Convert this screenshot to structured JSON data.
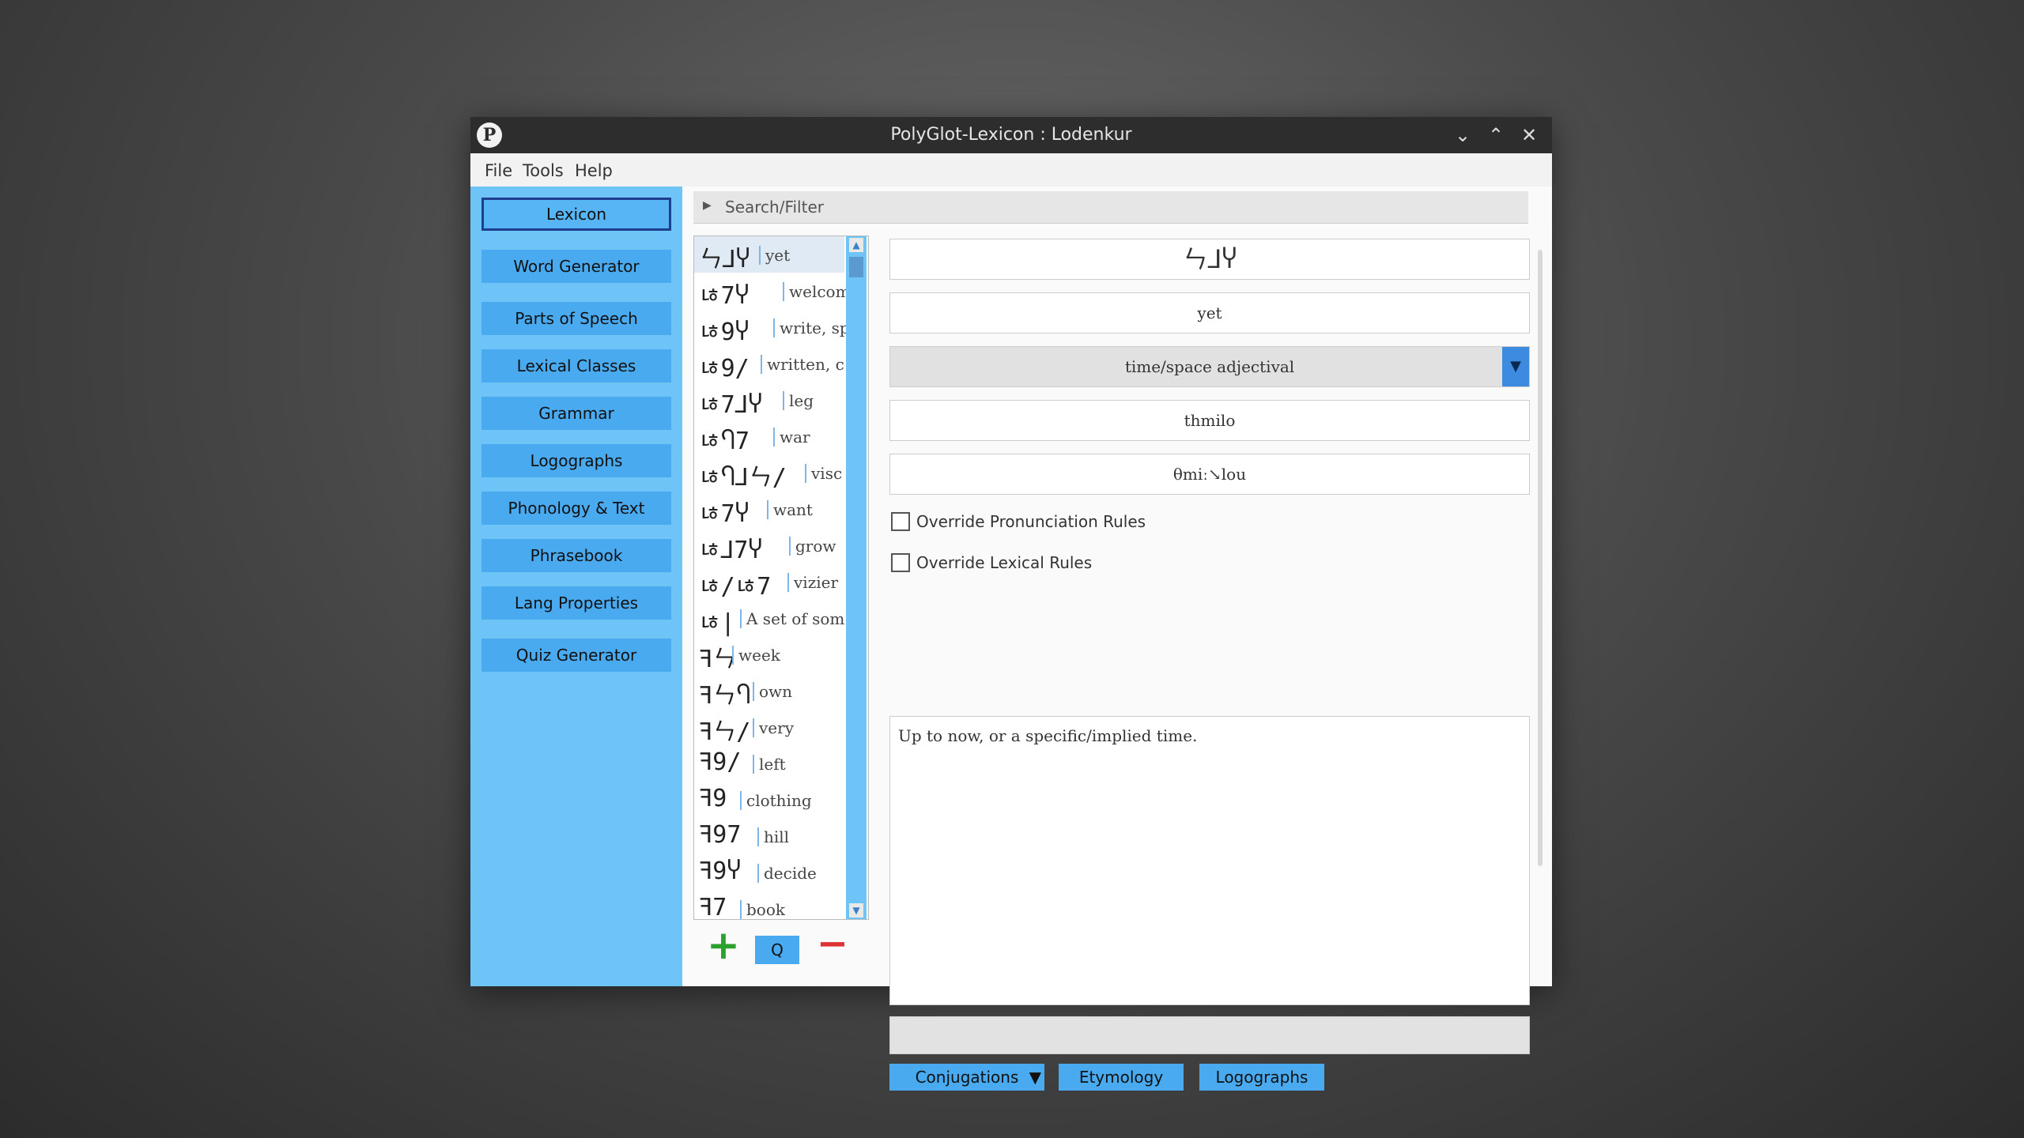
{
  "window": {
    "title": "PolyGlot-Lexicon : Lodenkur",
    "app_icon": "P",
    "controls": {
      "minimize": "⌄",
      "maximize": "⌃",
      "close": "✕"
    }
  },
  "menu": [
    "File",
    "Tools",
    "Help"
  ],
  "sidebar": {
    "items": [
      {
        "label": "Lexicon",
        "active": true
      },
      {
        "label": "Word Generator"
      },
      {
        "label": "Parts of Speech"
      },
      {
        "label": "Lexical Classes"
      },
      {
        "label": "Grammar"
      },
      {
        "label": "Logographs"
      },
      {
        "label": "Phonology & Text"
      },
      {
        "label": "Phrasebook"
      },
      {
        "label": "Lang Properties"
      },
      {
        "label": "Quiz Generator"
      }
    ]
  },
  "search": {
    "label": "Search/Filter",
    "arrow": "▶"
  },
  "word_list": [
    {
      "glyph": "ㄣ⅃Ⴤ",
      "gloss": "yet"
    },
    {
      "glyph": "ㄶ7Ⴤ",
      "gloss": "welcome"
    },
    {
      "glyph": "ㄶ9Ⴤ",
      "gloss": "write, sp"
    },
    {
      "glyph": "ㄶ9/",
      "gloss": "written, c"
    },
    {
      "glyph": "ㄶ7⅃Ⴤ",
      "gloss": "leg"
    },
    {
      "glyph": "ㄶႤ7",
      "gloss": "war"
    },
    {
      "glyph": "ㄶႤ⅃ㄣ/",
      "gloss": "visc"
    },
    {
      "glyph": "ㄶ7Ⴤ",
      "gloss": "want"
    },
    {
      "glyph": "ㄶ⅃7Ⴤ",
      "gloss": "grow"
    },
    {
      "glyph": "ㄶ/ㄶ7",
      "gloss": "vizier"
    },
    {
      "glyph": "ㄶ|",
      "gloss": "A set of som"
    },
    {
      "glyph": "ꟻㄣ",
      "gloss": "week"
    },
    {
      "glyph": "ꟻㄣႤ",
      "gloss": "own"
    },
    {
      "glyph": "ꟻㄣ/",
      "gloss": "very"
    },
    {
      "glyph": "ꟻ9/",
      "gloss": "left"
    },
    {
      "glyph": "ꟻ9",
      "gloss": "clothing"
    },
    {
      "glyph": "ꟻ97",
      "gloss": "hill"
    },
    {
      "glyph": "ꟻ9Ⴤ",
      "gloss": "decide"
    },
    {
      "glyph": "ꟻ7",
      "gloss": "book"
    }
  ],
  "list_buttons": {
    "add": "+",
    "search": "Q",
    "remove": "−"
  },
  "entry": {
    "conword": "ㄣ⅃Ⴤ",
    "local_word": "yet",
    "type": "time/space adjectival",
    "pronunciation": "thmilo",
    "ipa": "θmiː↘lou",
    "override_pronunciation": "Override Pronunciation Rules",
    "override_lexical": "Override Lexical Rules",
    "definition": "Up to now, or a specific/implied time."
  },
  "tabs": {
    "conjugations": "Conjugations",
    "etymology": "Etymology",
    "logographs": "Logographs",
    "dropdown": "▼"
  },
  "colors": {
    "sidebar": "#6ec3f7",
    "button": "#4aaaf0",
    "accent": "#3d8be0",
    "titlebar": "#2d2d2d"
  }
}
